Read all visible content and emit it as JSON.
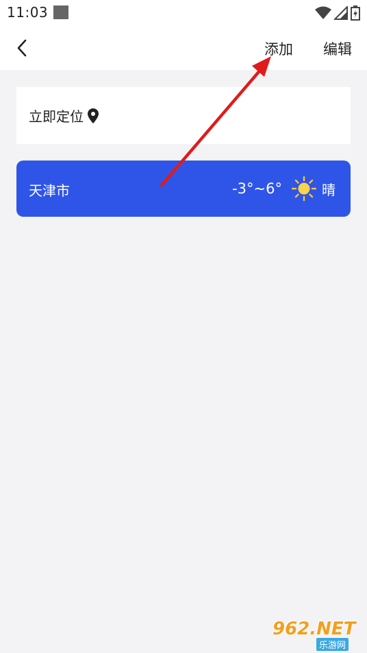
{
  "status_bar": {
    "time": "11:03"
  },
  "header": {
    "add_label": "添加",
    "edit_label": "编辑"
  },
  "locate": {
    "label": "立即定位"
  },
  "cities": [
    {
      "name": "天津市",
      "temperature": "-3°~6°",
      "condition": "晴",
      "icon": "sun-icon"
    }
  ],
  "colors": {
    "accent": "#2f55e8",
    "background": "#f3f3f6",
    "annotation": "#e01b1b"
  },
  "watermark": {
    "main": "962.NET",
    "sub": "乐游网"
  }
}
